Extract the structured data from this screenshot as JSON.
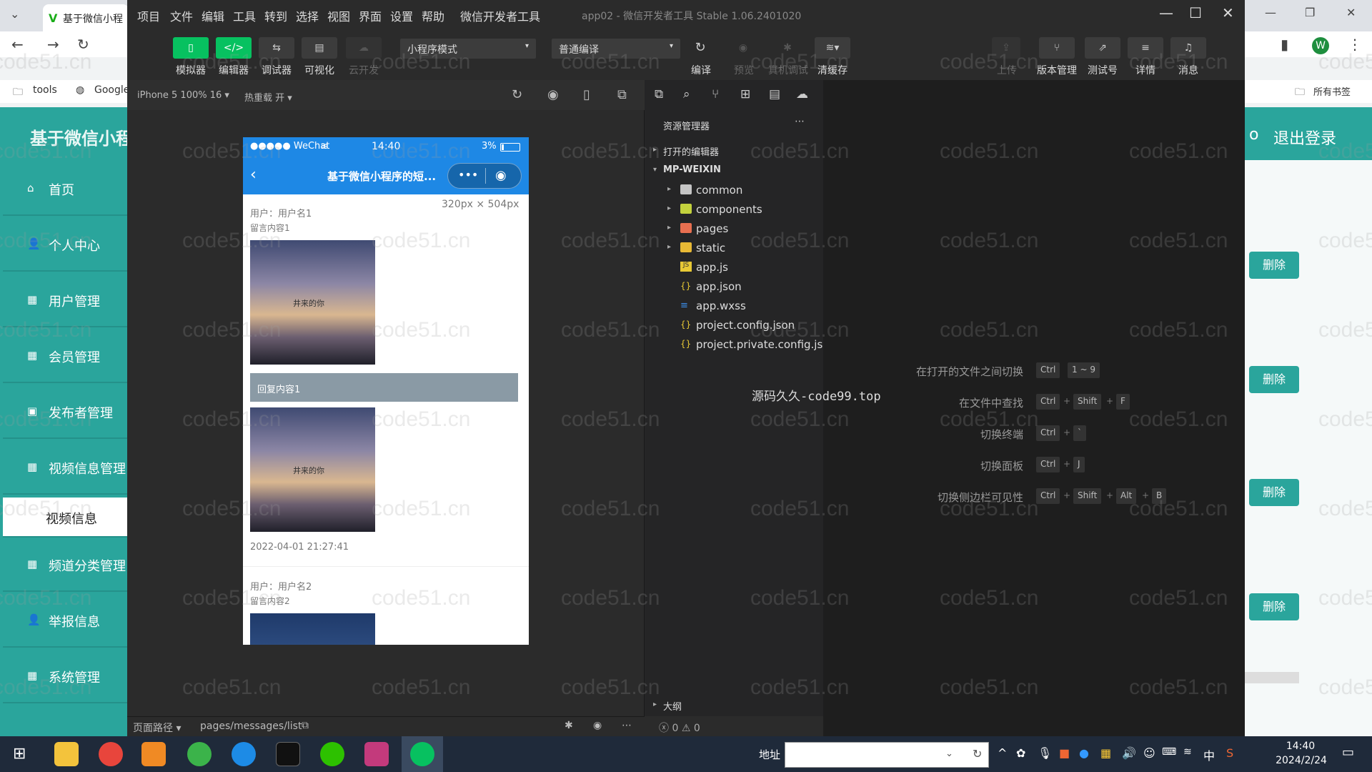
{
  "browser": {
    "tab_title": "基于微信小程",
    "bookmarks": [
      "tools",
      "Google"
    ],
    "all_bookmarks": "所有书签",
    "profile_letter": "W"
  },
  "admin": {
    "header_title": "基于微信小程",
    "logout": "退出登录",
    "nav": [
      {
        "label": "首页",
        "icon": "home-icon"
      },
      {
        "label": "个人中心",
        "icon": "user-icon"
      },
      {
        "label": "用户管理",
        "icon": "grid-icon"
      },
      {
        "label": "会员管理",
        "icon": "grid-icon"
      },
      {
        "label": "发布者管理",
        "icon": "monitor-icon"
      },
      {
        "label": "视频信息管理",
        "icon": "grid-icon"
      },
      {
        "label": "视频信息",
        "icon": ""
      },
      {
        "label": "频道分类管理",
        "icon": "grid-icon"
      },
      {
        "label": "举报信息",
        "icon": "user-icon"
      },
      {
        "label": "系统管理",
        "icon": "grid-icon"
      }
    ],
    "delete_label": "删除"
  },
  "devtools": {
    "menu": [
      "项目",
      "文件",
      "编辑",
      "工具",
      "转到",
      "选择",
      "视图",
      "界面",
      "设置",
      "帮助",
      "微信开发者工具"
    ],
    "window_title": "app02 - 微信开发者工具 Stable 1.06.2401020",
    "toolbar": {
      "simulator": "模拟器",
      "editor": "编辑器",
      "debugger": "调试器",
      "visual": "可视化",
      "cloud": "云开发",
      "mode": "小程序模式",
      "compile_mode": "普通编译",
      "compile": "编译",
      "preview": "预览",
      "real_debug": "真机调试",
      "clear_cache": "清缓存",
      "upload": "上传",
      "version": "版本管理",
      "test_account": "测试号",
      "details": "详情",
      "messages": "消息"
    },
    "sim": {
      "device": "iPhone 5 100% 16",
      "hot_reload": "热重载 开",
      "size_label": "320px × 504px",
      "path_label": "页面路径",
      "path": "pages/messages/list"
    },
    "phone": {
      "carrier": "●●●●● WeChat",
      "time": "14:40",
      "battery": "3%",
      "nav_title": "基于微信小程序的短...",
      "post1_user": "用户：用户名1",
      "post1_content": "留言内容1",
      "reply": "回复内容1",
      "post1_time": "2022-04-01 21:27:41",
      "post2_user": "用户：用户名2",
      "post2_content": "留言内容2",
      "image_caption": "井来的你"
    },
    "explorer": {
      "title": "资源管理器",
      "open_editors": "打开的编辑器",
      "root": "MP-WEIXIN",
      "items": [
        {
          "name": "common",
          "type": "folder"
        },
        {
          "name": "components",
          "type": "folder"
        },
        {
          "name": "pages",
          "type": "folder"
        },
        {
          "name": "static",
          "type": "folder"
        },
        {
          "name": "app.js",
          "type": "js"
        },
        {
          "name": "app.json",
          "type": "json"
        },
        {
          "name": "app.wxss",
          "type": "css"
        },
        {
          "name": "project.config.json",
          "type": "json"
        },
        {
          "name": "project.private.config.js...",
          "type": "json"
        }
      ],
      "outline": "大纲",
      "errors": "0",
      "warnings": "0"
    },
    "editor": {
      "watermark_text": "源码久久-code99.top",
      "shortcuts": [
        {
          "label": "在打开的文件之间切换",
          "keys": [
            "Ctrl",
            "1 ~ 9"
          ]
        },
        {
          "label": "在文件中查找",
          "keys": [
            "Ctrl",
            "Shift",
            "F"
          ]
        },
        {
          "label": "切换终端",
          "keys": [
            "Ctrl",
            "`"
          ]
        },
        {
          "label": "切换面板",
          "keys": [
            "Ctrl",
            "J"
          ]
        },
        {
          "label": "切换侧边栏可见性",
          "keys": [
            "Ctrl",
            "Shift",
            "Alt",
            "B"
          ]
        }
      ]
    }
  },
  "taskbar": {
    "address_label": "地址",
    "time": "14:40",
    "date": "2024/2/24",
    "ime": "中"
  },
  "watermark": "code51.cn"
}
